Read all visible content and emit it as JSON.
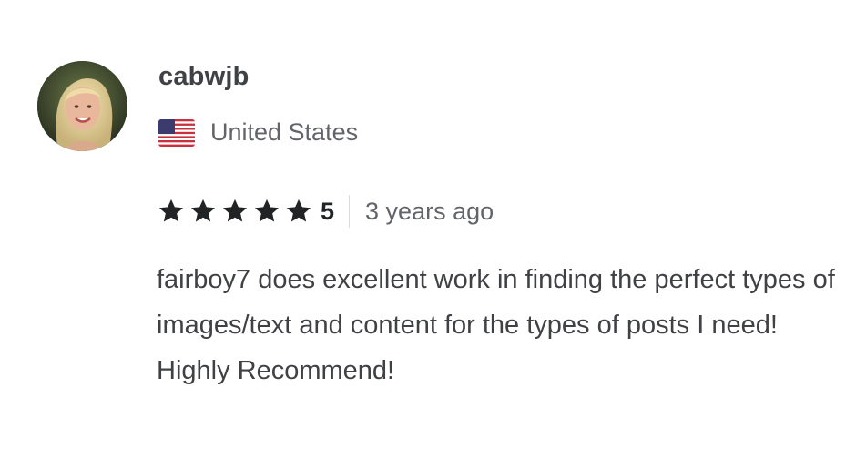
{
  "review": {
    "username": "cabwjb",
    "country": "United States",
    "flag_icon": "us-flag-icon",
    "rating": "5",
    "stars_filled": 5,
    "stars_total": 5,
    "time_ago": "3 years ago",
    "text": "fairboy7 does excellent work in finding the perfect types of images/text and content for the types of posts I need! Highly Recommend!"
  },
  "colors": {
    "star": "#222325",
    "text": "#404145",
    "muted": "#62646a"
  }
}
